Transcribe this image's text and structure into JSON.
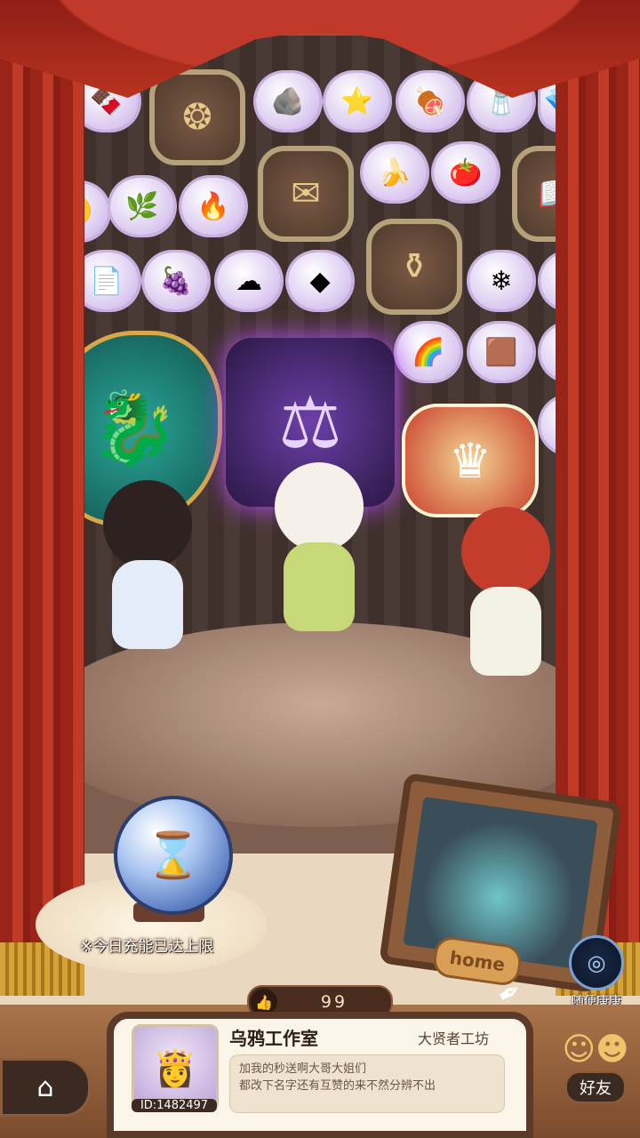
{
  "stage": {
    "shelf_icons": [
      "chocolate-icon",
      "clock-slot-icon",
      "ore-icon",
      "star-icon",
      "meat-icon",
      "salt-icon",
      "moon-icon",
      "herb-icon",
      "amber-icon",
      "scroll-slot-icon",
      "banana-icon",
      "tomato-icon",
      "book-slot-icon",
      "paper-icon",
      "grape-icon",
      "cotton-icon",
      "stone-icon",
      "cauldron-slot-icon",
      "crystal-icon",
      "pearl-icon",
      "rainbow-icon",
      "brownie-icon",
      "grain-icon",
      "honey-icon"
    ]
  },
  "left_panel": {
    "notice": "※今日充能已达上限"
  },
  "home_frame": {
    "label": "home"
  },
  "random_visit": {
    "label": "随便康康"
  },
  "likes": {
    "count": "99"
  },
  "profile": {
    "name": "乌鸦工作室",
    "title": "大贤者工坊",
    "message_line1": "加我的秒送啊大哥大姐们",
    "message_line2": "都改下名字还有互赞的来不然分辨不出",
    "id": "ID:1482497"
  },
  "nav": {
    "friends_label": "好友"
  }
}
